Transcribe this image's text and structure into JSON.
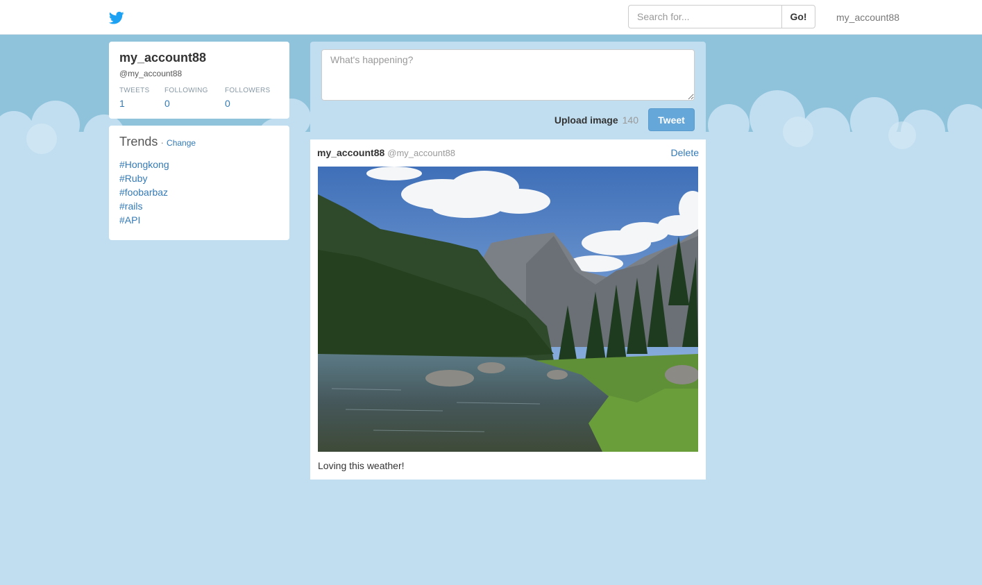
{
  "nav": {
    "logo_icon": "twitter-bird-icon",
    "search_placeholder": "Search for...",
    "search_button": "Go!",
    "user_link": "my_account88"
  },
  "profile": {
    "name": "my_account88",
    "handle": "@my_account88",
    "stats": [
      {
        "label": "TWEETS",
        "value": "1"
      },
      {
        "label": "FOLLOWING",
        "value": "0"
      },
      {
        "label": "FOLLOWERS",
        "value": "0"
      }
    ]
  },
  "trends": {
    "title": "Trends",
    "separator": "·",
    "change_label": "Change",
    "items": [
      "#Hongkong",
      "#Ruby",
      "#foobarbaz",
      "#rails",
      "#API"
    ]
  },
  "composer": {
    "placeholder": "What's happening?",
    "upload_label": "Upload image",
    "char_count": "140",
    "tweet_button": "Tweet"
  },
  "tweet": {
    "name": "my_account88",
    "handle": "@my_account88",
    "delete_label": "Delete",
    "image": "mountain-lake-photo",
    "text": "Loving this weather!"
  },
  "colors": {
    "brand": "#1da1f2",
    "link": "#337ab7",
    "page_bg": "#c1def0",
    "sky": "#8fc3dc",
    "tweet_button": "#65a7d9"
  }
}
